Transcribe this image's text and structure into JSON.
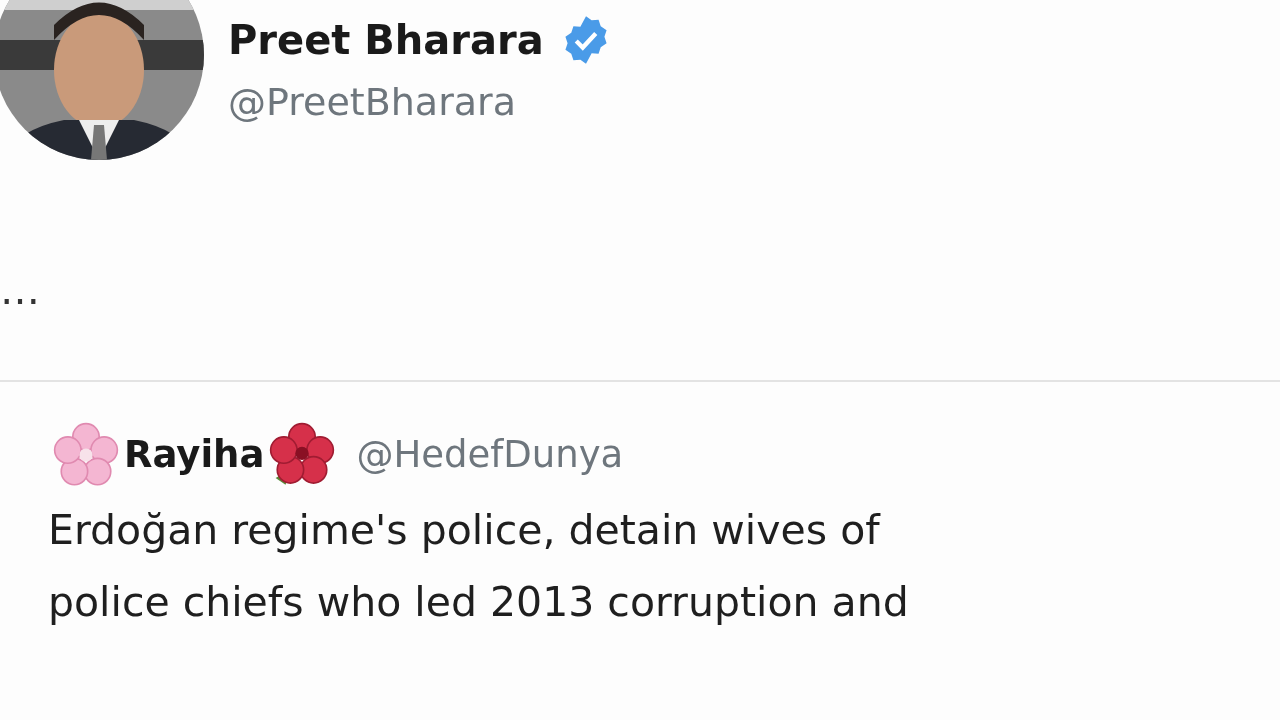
{
  "author": {
    "name": "Preet Bharara",
    "verified": true,
    "handle": "@PreetBharara"
  },
  "tweet": {
    "ellipsis": "…"
  },
  "quoted": {
    "name": "Rayiha",
    "handle": "@HedefDunya",
    "lines": [
      "Erdoğan regime's police, detain wives of",
      "police chiefs who led 2013 corruption and"
    ]
  }
}
